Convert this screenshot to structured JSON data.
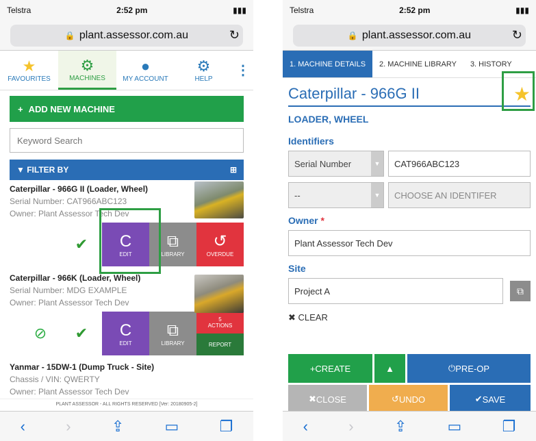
{
  "status": {
    "carrier": "Telstra",
    "time": "2:52 pm"
  },
  "url": {
    "host": "plant.assessor.com.au"
  },
  "left": {
    "tabs": [
      {
        "label": "FAVOURITES",
        "icon": "star-icon"
      },
      {
        "label": "MACHINES",
        "icon": "gear-icon"
      },
      {
        "label": "MY ACCOUNT",
        "icon": "person-icon"
      },
      {
        "label": "HELP",
        "icon": "help-gear-icon"
      }
    ],
    "add_button": "ADD NEW MACHINE",
    "search_placeholder": "Keyword Search",
    "filter_label": "FILTER BY",
    "machines": [
      {
        "title": "Caterpillar - 966G II (Loader, Wheel)",
        "line1": "Serial Number: CAT966ABC123",
        "line2": "Owner: Plant Assessor Tech Dev",
        "actions": {
          "edit": "EDIT",
          "library": "LIBRARY",
          "third": "OVERDUE"
        }
      },
      {
        "title": "Caterpillar - 966K (Loader, Wheel)",
        "line1": "Serial Number: MDG EXAMPLE",
        "line2": "Owner: Plant Assessor Tech Dev",
        "actions": {
          "edit": "EDIT",
          "library": "LIBRARY",
          "actions_count": "5",
          "actions_label": "ACTIONS",
          "report": "REPORT"
        }
      },
      {
        "title": "Yanmar - 15DW-1 (Dump Truck - Site)",
        "line1": "Chassis / VIN: QWERTY",
        "line2": "Owner: Plant Assessor Tech Dev"
      }
    ],
    "footer": "PLANT ASSESSOR - ALL RIGHTS RESERVED  [Ver: 20180905-2]"
  },
  "right": {
    "steps": [
      "1. MACHINE DETAILS",
      "2. MACHINE LIBRARY",
      "3. HISTORY"
    ],
    "machine_title": "Caterpillar - 966G II",
    "machine_type": "LOADER, WHEEL",
    "identifiers_label": "Identifiers",
    "identifiers": [
      {
        "type": "Serial Number",
        "value": "CAT966ABC123"
      },
      {
        "type": "--",
        "value": "CHOOSE AN IDENTIFER"
      }
    ],
    "owner_label": "Owner",
    "owner_required": "*",
    "owner_value": "Plant Assessor Tech Dev",
    "site_label": "Site",
    "site_value": "Project A",
    "clear_label": "CLEAR",
    "buttons": {
      "create": "CREATE",
      "preop": "PRE-OP",
      "close": "CLOSE",
      "undo": "UNDO",
      "save": "SAVE"
    }
  }
}
